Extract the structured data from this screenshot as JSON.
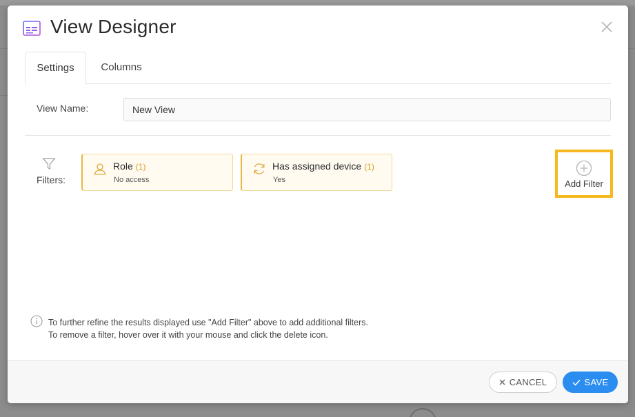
{
  "dialog": {
    "title": "View Designer",
    "icon": "view-designer-icon",
    "close_icon": "close-icon"
  },
  "tabs": [
    {
      "label": "Settings",
      "active": true
    },
    {
      "label": "Columns",
      "active": false
    }
  ],
  "settings": {
    "view_name_label": "View Name:",
    "view_name_value": "New View"
  },
  "filters": {
    "label": "Filters:",
    "items": [
      {
        "name": "Role",
        "count": "(1)",
        "value": "No access",
        "icon": "user-icon"
      },
      {
        "name": "Has assigned device",
        "count": "(1)",
        "value": "Yes",
        "icon": "sync-icon"
      }
    ],
    "add_label": "Add Filter"
  },
  "info": {
    "line1": "To further refine the results displayed use \"Add Filter\" above to add additional filters.",
    "line2": "To remove a filter, hover over it with your mouse and click the delete icon."
  },
  "footer": {
    "cancel_label": "CANCEL",
    "save_label": "SAVE"
  },
  "colors": {
    "accent": "#2b8df0",
    "chip_border": "#e9b740",
    "highlight": "#f5b91e",
    "chip_count": "#d99a1c"
  }
}
